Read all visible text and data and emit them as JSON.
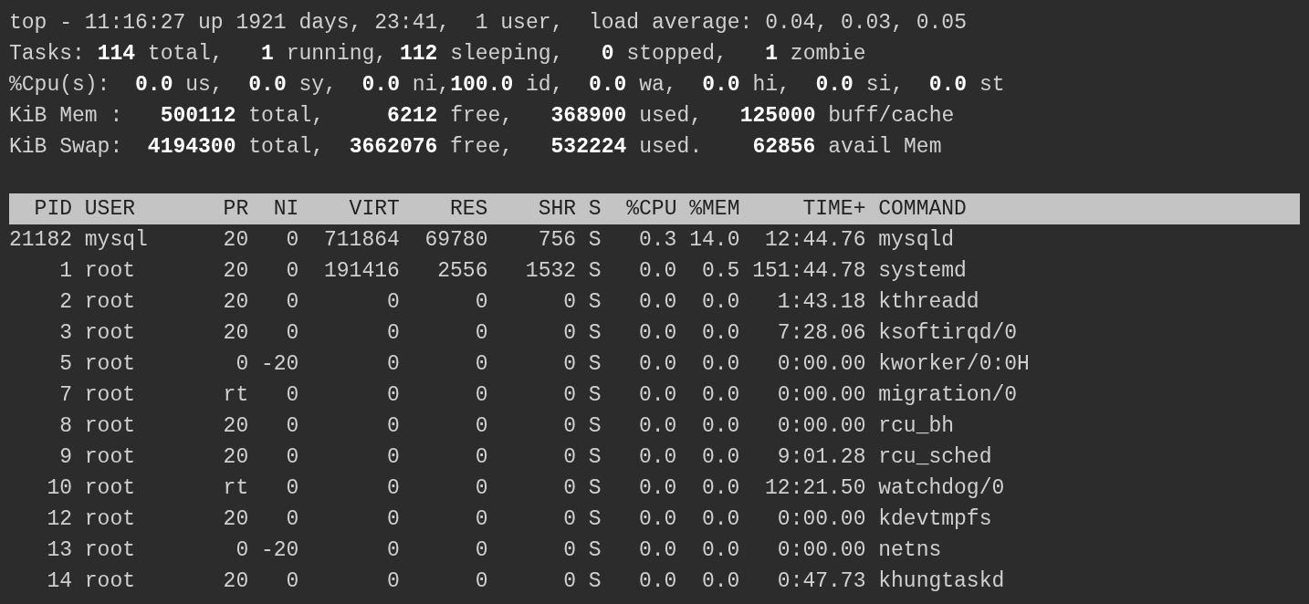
{
  "summary_lines": [
    "top - 11:16:27 up 1921 days, 23:41,  1 user,  load average: 0.04, 0.03, 0.05",
    "Tasks: **114** total,   **1** running, **112** sleeping,   **0** stopped,   **1** zombie",
    "%Cpu(s):  **0.0** us,  **0.0** sy,  **0.0** ni,**100.0** id,  **0.0** wa,  **0.0** hi,  **0.0** si,  **0.0** st",
    "KiB Mem :   **500112** total,     **6212** free,   **368900** used,   **125000** buff/cache",
    "KiB Swap:  **4194300** total,  **3662076** free,   **532224** used.    **62856** avail Mem"
  ],
  "table": {
    "columns": [
      "PID",
      "USER",
      "PR",
      "NI",
      "VIRT",
      "RES",
      "SHR",
      "S",
      "%CPU",
      "%MEM",
      "TIME+",
      "COMMAND"
    ],
    "rows": [
      {
        "cells": [
          "21182",
          "mysql",
          "20",
          "0",
          "711864",
          "69780",
          "756",
          "S",
          "0.3",
          "14.0",
          "12:44.76",
          "mysqld"
        ]
      },
      {
        "cells": [
          "1",
          "root",
          "20",
          "0",
          "191416",
          "2556",
          "1532",
          "S",
          "0.0",
          "0.5",
          "151:44.78",
          "systemd"
        ]
      },
      {
        "cells": [
          "2",
          "root",
          "20",
          "0",
          "0",
          "0",
          "0",
          "S",
          "0.0",
          "0.0",
          "1:43.18",
          "kthreadd"
        ]
      },
      {
        "cells": [
          "3",
          "root",
          "20",
          "0",
          "0",
          "0",
          "0",
          "S",
          "0.0",
          "0.0",
          "7:28.06",
          "ksoftirqd/0"
        ]
      },
      {
        "cells": [
          "5",
          "root",
          "0",
          "-20",
          "0",
          "0",
          "0",
          "S",
          "0.0",
          "0.0",
          "0:00.00",
          "kworker/0:0H"
        ]
      },
      {
        "cells": [
          "7",
          "root",
          "rt",
          "0",
          "0",
          "0",
          "0",
          "S",
          "0.0",
          "0.0",
          "0:00.00",
          "migration/0"
        ]
      },
      {
        "cells": [
          "8",
          "root",
          "20",
          "0",
          "0",
          "0",
          "0",
          "S",
          "0.0",
          "0.0",
          "0:00.00",
          "rcu_bh"
        ]
      },
      {
        "cells": [
          "9",
          "root",
          "20",
          "0",
          "0",
          "0",
          "0",
          "S",
          "0.0",
          "0.0",
          "9:01.28",
          "rcu_sched"
        ]
      },
      {
        "cells": [
          "10",
          "root",
          "rt",
          "0",
          "0",
          "0",
          "0",
          "S",
          "0.0",
          "0.0",
          "12:21.50",
          "watchdog/0"
        ]
      },
      {
        "cells": [
          "12",
          "root",
          "20",
          "0",
          "0",
          "0",
          "0",
          "S",
          "0.0",
          "0.0",
          "0:00.00",
          "kdevtmpfs"
        ]
      },
      {
        "cells": [
          "13",
          "root",
          "0",
          "-20",
          "0",
          "0",
          "0",
          "S",
          "0.0",
          "0.0",
          "0:00.00",
          "netns"
        ]
      },
      {
        "cells": [
          "14",
          "root",
          "20",
          "0",
          "0",
          "0",
          "0",
          "S",
          "0.0",
          "0.0",
          "0:47.73",
          "khungtaskd"
        ]
      }
    ]
  }
}
